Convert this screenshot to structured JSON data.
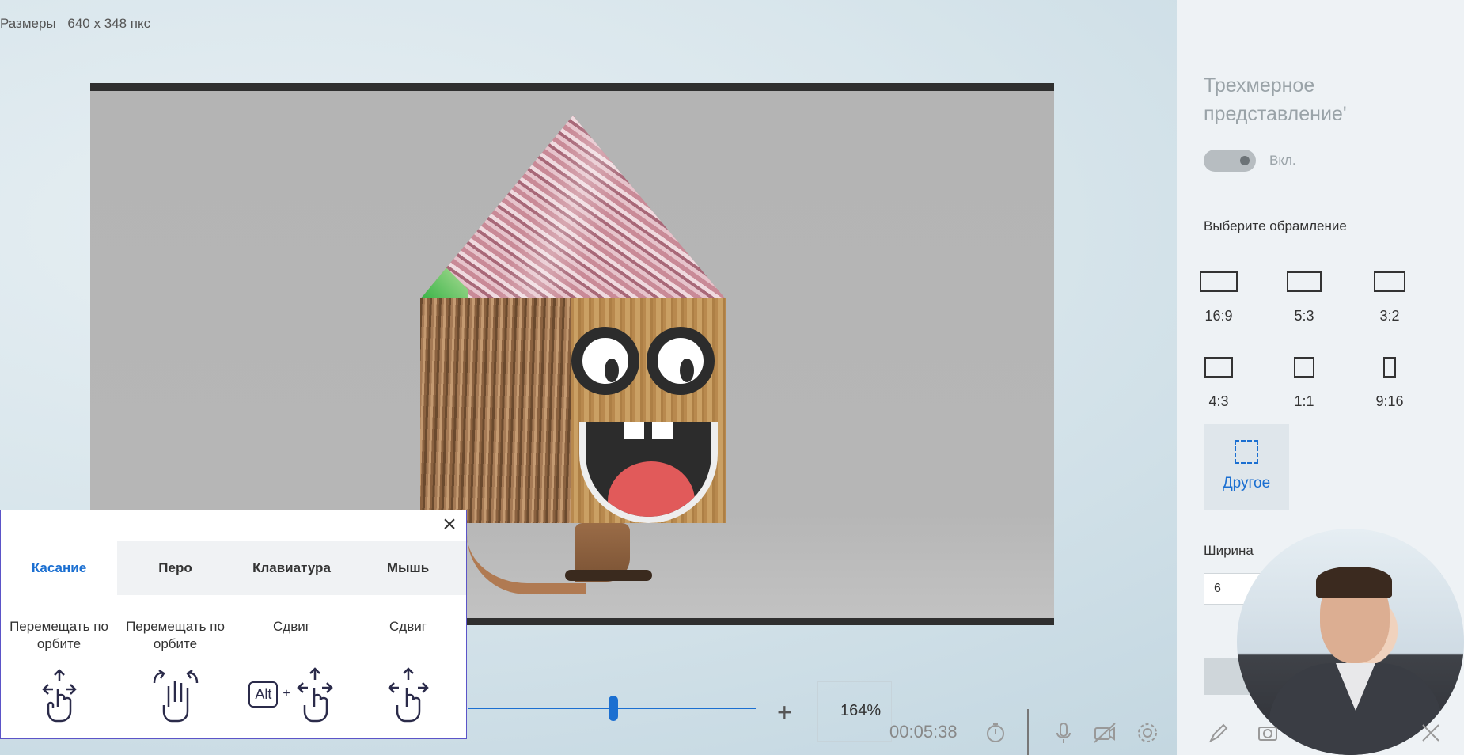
{
  "header": {
    "size_label": "Размеры",
    "size_value": "640 x 348 пкс"
  },
  "panel": {
    "title": "Трехмерное представление'",
    "toggle_label": "Вкл.",
    "frame_section_label": "Выберите обрамление",
    "ratios": [
      {
        "label": "16:9",
        "shape": "wide"
      },
      {
        "label": "5:3",
        "shape": "wide"
      },
      {
        "label": "3:2",
        "shape": "wide"
      },
      {
        "label": "4:3",
        "shape": "standard"
      },
      {
        "label": "1:1",
        "shape": "square"
      },
      {
        "label": "9:16",
        "shape": "tall"
      }
    ],
    "other_label": "Другое",
    "width_label": "Ширина",
    "width_value": "6"
  },
  "help": {
    "tabs": [
      "Касание",
      "Перо",
      "Клавиатура",
      "Мышь"
    ],
    "active_tab": "Касание",
    "actions": [
      "Перемещать по орбите",
      "Перемещать по орбите",
      "Сдвиг",
      "Сдвиг"
    ],
    "alt_key": "Alt",
    "plus": "+"
  },
  "bottom_bar": {
    "zoom_value": "164%",
    "timer": "00:05:38",
    "icons": [
      "zoom-plus-icon",
      "timer-icon",
      "microphone-icon",
      "camera-off-icon",
      "settings-icon",
      "pen-icon",
      "camera-icon",
      "close-icon"
    ]
  },
  "colors": {
    "accent": "#1b6fd1",
    "panel_bg": "#eef2f5",
    "canvas_bg": "#b4b4b4",
    "help_border": "#5b54c8"
  }
}
